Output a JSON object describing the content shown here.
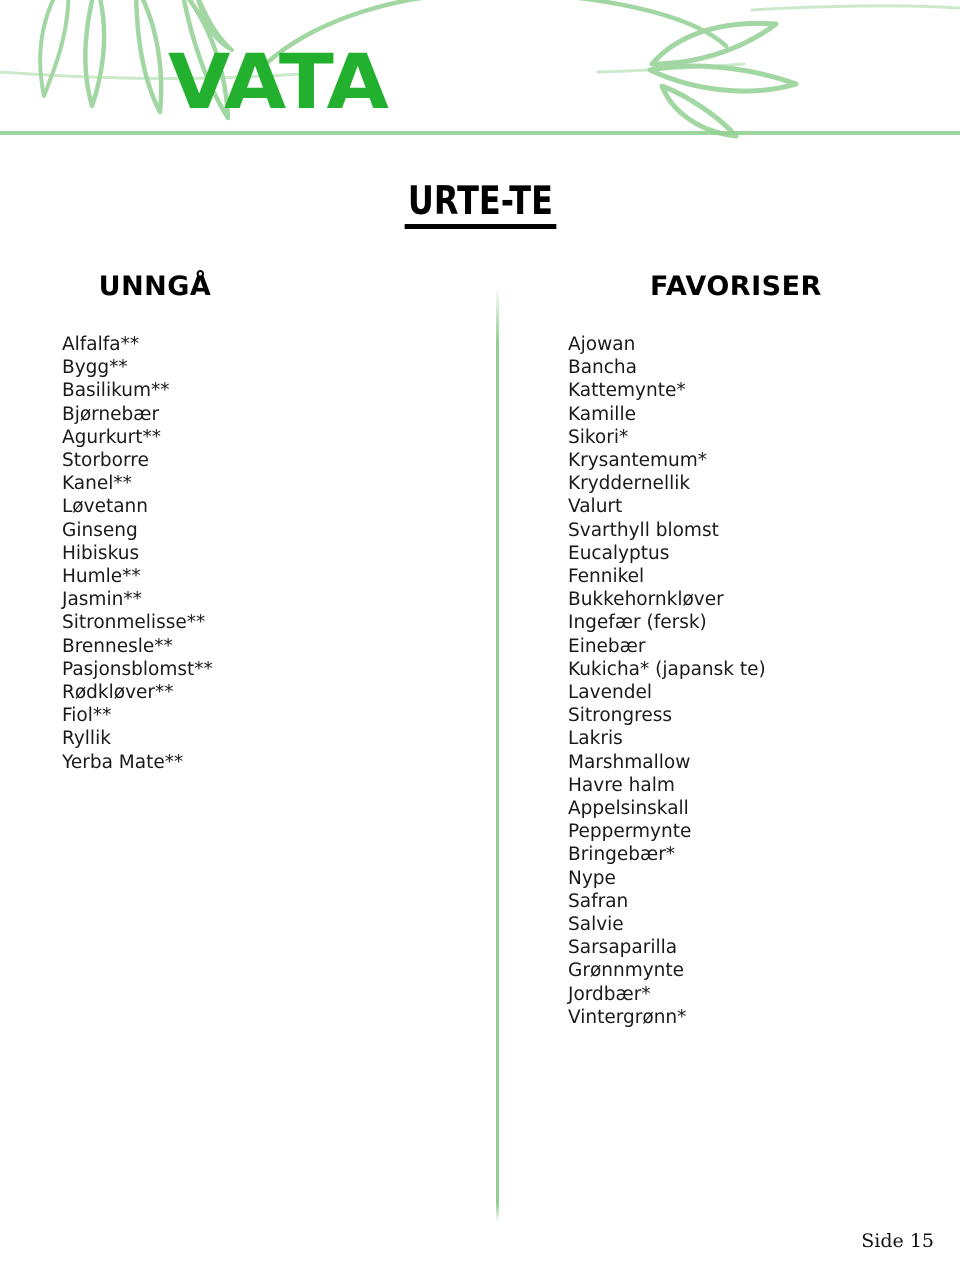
{
  "header": {
    "brand_title": "VATA",
    "brand_color": "#22b02e",
    "decoration_color": "#92d092",
    "decoration_name": "leaf-branch-decoration"
  },
  "page_title": "URTE-TE",
  "columns": [
    {
      "id": "avoid",
      "heading": "UNNGÅ",
      "items": [
        "Alfalfa**",
        "Bygg**",
        "Basilikum**",
        "Bjørnebær",
        "Agurkurt**",
        "Storborre",
        "Kanel**",
        "Løvetann",
        "Ginseng",
        "Hibiskus",
        "Humle**",
        "Jasmin**",
        "Sitronmelisse**",
        "Brennesle**",
        "Pasjonsblomst**",
        "Rødkløver**",
        "Fiol**",
        "Ryllik",
        "Yerba Mate**"
      ]
    },
    {
      "id": "favor",
      "heading": "FAVORISER",
      "items": [
        "Ajowan",
        "Bancha",
        "Kattemynte*",
        "Kamille",
        "Sikori*",
        "Krysantemum*",
        "Kryddernellik",
        "Valurt",
        "Svarthyll blomst",
        "Eucalyptus",
        "Fennikel",
        "Bukkehornkløver",
        "Ingefær (fersk)",
        "Einebær",
        "Kukicha* (japansk te)",
        "Lavendel",
        "Sitrongress",
        "Lakris",
        "Marshmallow",
        "Havre halm",
        "Appelsinskall",
        "Peppermynte",
        "Bringebær*",
        "Nype",
        "Safran",
        "Salvie",
        "Sarsaparilla",
        "Grønnmynte",
        "Jordbær*",
        "Vintergrønn*"
      ]
    }
  ],
  "footer": {
    "page_label": "Side 15"
  }
}
